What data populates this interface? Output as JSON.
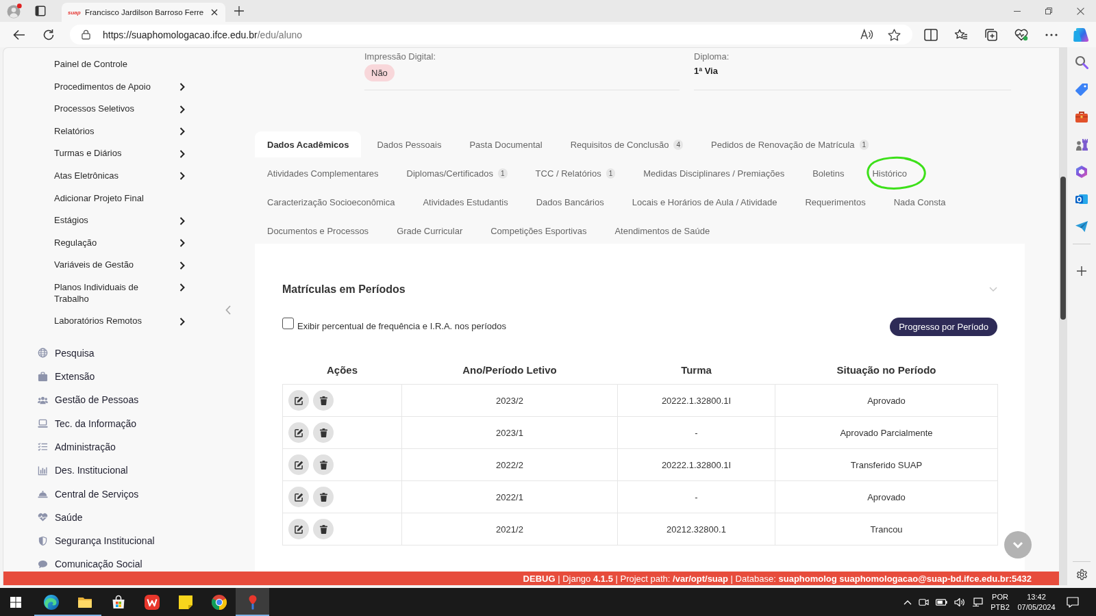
{
  "browser": {
    "favicon_text": "suap",
    "tab_title": "Francisco Jardilson Barroso Ferre",
    "url_host": "https://suaphomologacao.ifce.edu.br",
    "url_path": "/edu/aluno"
  },
  "sidebar": {
    "submenu": [
      {
        "label": "Painel de Controle",
        "expandable": false
      },
      {
        "label": "Procedimentos de Apoio",
        "expandable": true
      },
      {
        "label": "Processos Seletivos",
        "expandable": true
      },
      {
        "label": "Relatórios",
        "expandable": true
      },
      {
        "label": "Turmas e Diários",
        "expandable": true
      },
      {
        "label": "Atas Eletrônicas",
        "expandable": true
      },
      {
        "label": "Adicionar Projeto Final",
        "expandable": false
      },
      {
        "label": "Estágios",
        "expandable": true
      },
      {
        "label": "Regulação",
        "expandable": true
      },
      {
        "label": "Variáveis de Gestão",
        "expandable": true
      },
      {
        "label": "Planos Individuais de Trabalho",
        "expandable": true
      },
      {
        "label": "Laboratórios Remotos",
        "expandable": true
      }
    ],
    "modules": [
      {
        "label": "Pesquisa"
      },
      {
        "label": "Extensão"
      },
      {
        "label": "Gestão de Pessoas"
      },
      {
        "label": "Tec. da Informação"
      },
      {
        "label": "Administração"
      },
      {
        "label": "Des. Institucional"
      },
      {
        "label": "Central de Serviços"
      },
      {
        "label": "Saúde"
      },
      {
        "label": "Segurança Institucional"
      },
      {
        "label": "Comunicação Social"
      }
    ]
  },
  "details": [
    {
      "label": "Impressão Digital:",
      "value": "Não",
      "kind": "badge"
    },
    {
      "label": "Diploma:",
      "value": "1ª Via",
      "kind": "text"
    }
  ],
  "tabs": {
    "rows": [
      [
        {
          "label": "Dados Acadêmicos",
          "selected": true,
          "circled": false
        },
        {
          "label": "Dados Pessoais",
          "selected": false,
          "circled": false
        },
        {
          "label": "Pasta Documental",
          "selected": false,
          "circled": false
        },
        {
          "label": "Requisitos de Conclusão",
          "count": "4",
          "selected": false,
          "circled": false
        },
        {
          "label": "Pedidos de Renovação de Matrícula",
          "count": "1",
          "selected": false,
          "circled": false
        }
      ],
      [
        {
          "label": "Atividades Complementares",
          "selected": false,
          "circled": false
        },
        {
          "label": "Diplomas/Certificados",
          "count": "1",
          "selected": false,
          "circled": false
        },
        {
          "label": "TCC / Relatórios",
          "count": "1",
          "selected": false,
          "circled": false
        },
        {
          "label": "Medidas Disciplinares / Premiações",
          "selected": false,
          "circled": false
        },
        {
          "label": "Boletins",
          "selected": false,
          "circled": false
        },
        {
          "label": "Histórico",
          "selected": false,
          "circled": true
        }
      ],
      [
        {
          "label": "Caracterização Socioeconômica",
          "selected": false,
          "circled": false
        },
        {
          "label": "Atividades Estudantis",
          "selected": false,
          "circled": false
        },
        {
          "label": "Dados Bancários",
          "selected": false,
          "circled": false
        },
        {
          "label": "Locais e Horários de Aula / Atividade",
          "selected": false,
          "circled": false
        },
        {
          "label": "Requerimentos",
          "selected": false,
          "circled": false
        },
        {
          "label": "Nada Consta",
          "selected": false,
          "circled": false
        }
      ],
      [
        {
          "label": "Documentos e Processos",
          "selected": false,
          "circled": false
        },
        {
          "label": "Grade Curricular",
          "selected": false,
          "circled": false
        },
        {
          "label": "Competições Esportivas",
          "selected": false,
          "circled": false
        },
        {
          "label": "Atendimentos de Saúde",
          "selected": false,
          "circled": false
        }
      ]
    ]
  },
  "enrollments": {
    "title": "Matrículas em Períodos",
    "checkbox": {
      "label": "Exibir percentual de frequência e I.R.A. nos períodos",
      "checked": false
    },
    "button": "Progresso por Período",
    "columns": [
      "Ações",
      "Ano/Período Letivo",
      "Turma",
      "Situação no Período"
    ],
    "rows": [
      {
        "period": "2023/2",
        "class": "20222.1.32800.1I",
        "status": "Aprovado"
      },
      {
        "period": "2023/1",
        "class": "-",
        "status": "Aprovado Parcialmente"
      },
      {
        "period": "2022/2",
        "class": "20222.1.32800.1I",
        "status": "Transferido SUAP"
      },
      {
        "period": "2022/1",
        "class": "-",
        "status": "Aprovado"
      },
      {
        "period": "2021/2",
        "class": "20212.32800.1",
        "status": "Trancou"
      }
    ]
  },
  "debug_bar": "**DEBUG** | Django **4.1.5** | Project path: **/var/opt/suap** | Database: **suaphomolog suaphomologacao@suap-bd.ifce.edu.br:5432**",
  "taskbar": {
    "apps": [
      {
        "running": true,
        "selected": false
      },
      {
        "running": true,
        "selected": false
      },
      {
        "running": false,
        "selected": false
      },
      {
        "running": false,
        "selected": false
      },
      {
        "running": false,
        "selected": false
      },
      {
        "running": false,
        "selected": false
      },
      {
        "running": true,
        "selected": true
      }
    ],
    "language": [
      "POR",
      "PTB2"
    ],
    "time": "13:42",
    "date": "07/05/2024"
  }
}
